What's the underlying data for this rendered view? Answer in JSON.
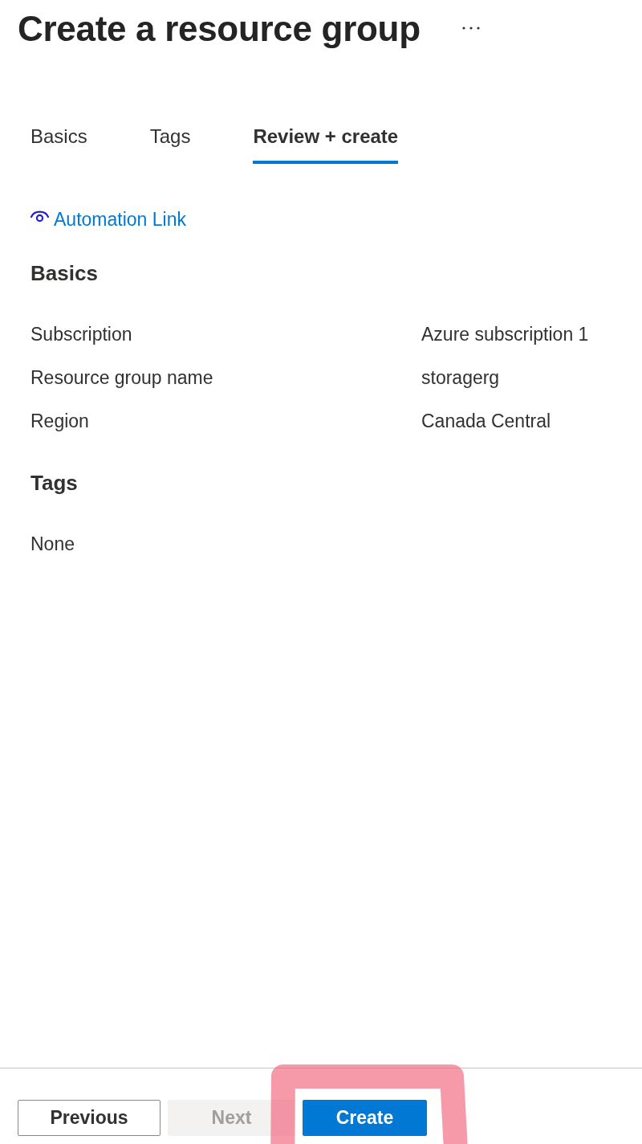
{
  "header": {
    "title": "Create a resource group"
  },
  "tabs": [
    {
      "label": "Basics",
      "selected": false
    },
    {
      "label": "Tags",
      "selected": false
    },
    {
      "label": "Review + create",
      "selected": true
    }
  ],
  "automation_link": {
    "label": "Automation Link"
  },
  "sections": [
    {
      "kind": "fields",
      "heading": "Basics",
      "fields": [
        {
          "label": "Subscription",
          "value": "Azure subscription 1"
        },
        {
          "label": "Resource group name",
          "value": "storagerg"
        },
        {
          "label": "Region",
          "value": "Canada Central"
        }
      ]
    },
    {
      "kind": "text",
      "heading": "Tags",
      "text": "None"
    }
  ],
  "footer": {
    "buttons": [
      {
        "label": "Previous",
        "kind": "secondary",
        "disabled": false,
        "highlighted": false
      },
      {
        "label": "Next",
        "kind": "secondary",
        "disabled": true,
        "highlighted": false
      },
      {
        "label": "Create",
        "kind": "primary",
        "disabled": false,
        "highlighted": true
      }
    ]
  }
}
